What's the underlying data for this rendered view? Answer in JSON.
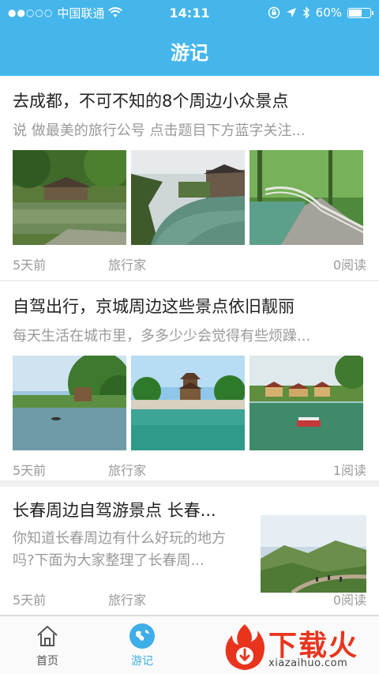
{
  "status": {
    "carrier": "中国联通",
    "time": "14:11",
    "battery": "60%",
    "battery_level": 0.6
  },
  "header": {
    "title": "游记"
  },
  "articles": [
    {
      "title": "去成都，不可不知的8个周边小众景点",
      "subtitle": "说 做最美的旅行公号 点击题目下方蓝字关注...",
      "date": "5天前",
      "author": "旅行家",
      "reads": "0阅读"
    },
    {
      "title": "自驾出行，京城周边这些景点依旧靓丽",
      "subtitle": "每天生活在城市里，多多少少会觉得有些烦躁...",
      "date": "5天前",
      "author": "旅行家",
      "reads": "1阅读"
    },
    {
      "title": "长春周边自驾游景点 长春...",
      "subtitle": "你知道长春周边有什么好玩的地方吗?下面为大家整理了长春周...",
      "date": "5天前",
      "author": "旅行家",
      "reads": "0阅读"
    }
  ],
  "tabbar": {
    "home_label": "首页",
    "journal_label": "游记"
  },
  "watermark": {
    "text": "下载火",
    "url": "xiazaihuo.com"
  },
  "colors": {
    "header": "#44b6ec",
    "active_tab": "#3eaee8",
    "watermark": "#e8341d"
  }
}
